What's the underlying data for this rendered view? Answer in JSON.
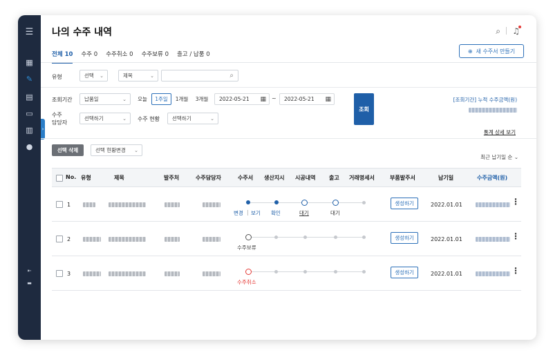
{
  "header": {
    "title": "나의 수주 내역"
  },
  "tabs": [
    {
      "label": "전체 10",
      "active": true
    },
    {
      "label": "수주 0"
    },
    {
      "label": "수주취소 0"
    },
    {
      "label": "수주보류 0"
    },
    {
      "label": "출고 / 납품 0"
    }
  ],
  "actions": {
    "new_order": "새 수주서 만들기"
  },
  "filters": {
    "type_label": "유형",
    "type_value": "선택",
    "title_value": "제목",
    "period_label": "조회기간",
    "period_basis": "납품일",
    "periods": [
      "오늘",
      "1주일",
      "1개월",
      "3개월"
    ],
    "date_from": "2022-05-21",
    "date_to": "2022-05-21",
    "tilde": "~",
    "manager_label_1": "수주",
    "manager_label_2": "담당자",
    "manager_value": "선택하기",
    "status_label": "수주 현황",
    "status_value": "선택하기",
    "search": "조회",
    "cumulative_label": "[조회기간] 누적 수주금액(원)",
    "stats_link": "통계 상세 보기"
  },
  "list": {
    "delete_btn": "선택 삭제",
    "status_change": "선택 현황변경",
    "sort": "최근 납기일 순 ⌄",
    "columns": [
      "No.",
      "유형",
      "제목",
      "발주처",
      "수주담당자",
      "수주서",
      "생산지시",
      "시공내역",
      "출고",
      "거래명세서",
      "부품발주서",
      "납기일",
      "수주금액(원)"
    ],
    "rows": [
      {
        "no": "1",
        "gen": "생성하기",
        "due": "2022.01.01",
        "stage_a": "변경",
        "stage_sep": "|",
        "stage_b": "보기",
        "stage_c": "확인",
        "stage_d": "대기",
        "stage_e": "대기"
      },
      {
        "no": "2",
        "gen": "생성하기",
        "due": "2022.01.01",
        "stage_a": "수주보류"
      },
      {
        "no": "3",
        "gen": "생성하기",
        "due": "2022.01.01",
        "stage_a": "수주취소"
      }
    ]
  },
  "colors": {
    "accent": "#1f5fa8",
    "sidebar": "#1e2a3f",
    "cancel": "#e53935"
  }
}
